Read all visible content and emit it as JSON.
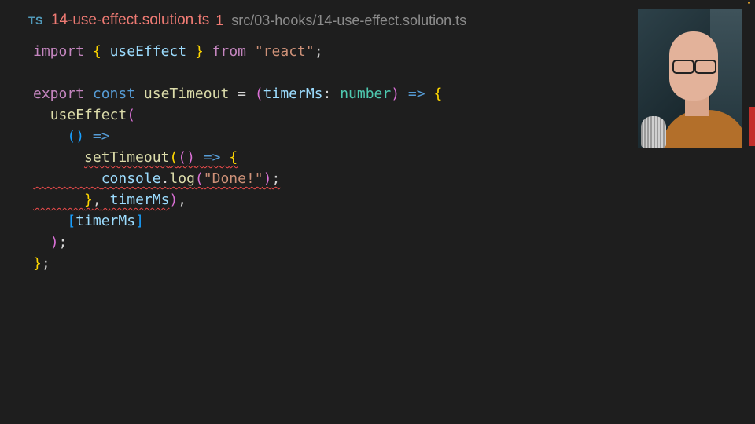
{
  "tab": {
    "language_badge": "TS",
    "file_name": "14-use-effect.solution.ts",
    "problem_count": "1",
    "path": "src/03-hooks/14-use-effect.solution.ts"
  },
  "code": {
    "l1": {
      "t1": "import",
      "t2": "{",
      "t3": "useEffect",
      "t4": "}",
      "t5": "from",
      "t6": "\"react\"",
      "t7": ";"
    },
    "l3": {
      "t1": "export",
      "t2": "const",
      "t3": "useTimeout",
      "t4": "=",
      "t5": "(",
      "t6": "timerMs",
      "t7": ":",
      "t8": "number",
      "t9": ")",
      "t10": "=>",
      "t11": "{"
    },
    "l4": {
      "t1": "useEffect",
      "t2": "("
    },
    "l5": {
      "t1": "()",
      "t2": "=>"
    },
    "l6": {
      "t1": "setTimeout",
      "t2": "(",
      "t3": "()",
      "t4": "=>",
      "t5": "{"
    },
    "l7": {
      "t1": "console",
      "t2": ".",
      "t3": "log",
      "t4": "(",
      "t5": "\"Done!\"",
      "t6": ")",
      "t7": ";"
    },
    "l8": {
      "t1": "}",
      "t2": ",",
      "t3": "timerMs",
      "t4": ")",
      "t5": ","
    },
    "l9": {
      "t1": "[",
      "t2": "timerMs",
      "t3": "]"
    },
    "l10": {
      "t1": ")",
      "t2": ";"
    },
    "l11": {
      "t1": "}",
      "t2": ";"
    }
  },
  "colors": {
    "background": "#1e1e1e",
    "error_squiggle": "#f14c4c",
    "tab_error_text": "#f07b74"
  }
}
